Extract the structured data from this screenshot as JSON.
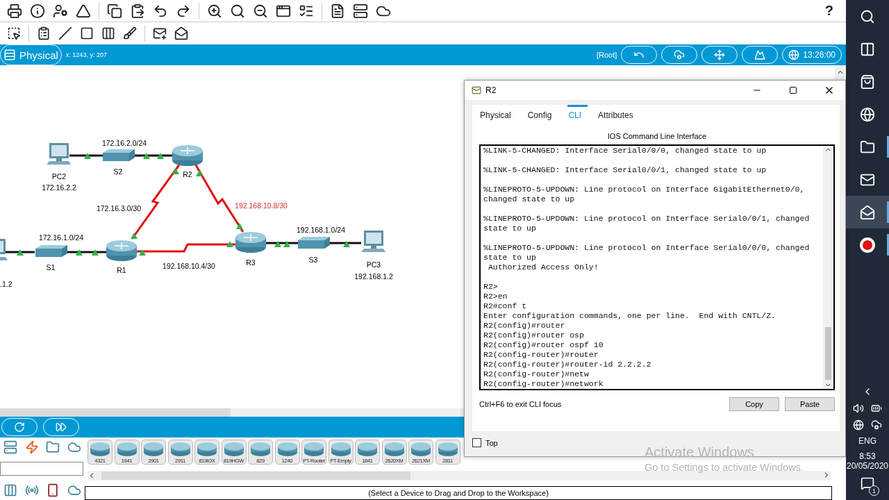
{
  "toolbar": {
    "help": "?"
  },
  "mode_bar": {
    "mode": "Physical",
    "coordinates": "x: 1243, y: 207",
    "root": "[Root]",
    "time": "13:26:00"
  },
  "topology": {
    "devices": [
      {
        "kind": "pc",
        "name": "PC2",
        "address": "172.16.2.2"
      },
      {
        "kind": "switch",
        "name": "S2"
      },
      {
        "kind": "router",
        "name": "R2"
      },
      {
        "kind": "pc",
        "address": ".1.2"
      },
      {
        "kind": "switch",
        "name": "S1"
      },
      {
        "kind": "router",
        "name": "R1"
      },
      {
        "kind": "router",
        "name": "R3"
      },
      {
        "kind": "switch",
        "name": "S3"
      },
      {
        "kind": "pc",
        "name": "PC3",
        "address": "192.168.1.2"
      }
    ],
    "networks": [
      {
        "label": "172.16.2.0/24"
      },
      {
        "label": "172.16.3.0/30"
      },
      {
        "label": "192.168.10.8/30",
        "color": "#d0312d"
      },
      {
        "label": "172.16.1.0/24"
      },
      {
        "label": "192.168.10.4/30"
      },
      {
        "label": "192.168.1.0/24"
      }
    ]
  },
  "device_panel": {
    "models": [
      "4321",
      "1941",
      "2901",
      "2911",
      "819IOX",
      "819HGW",
      "829",
      "1240",
      "PT-Router",
      "PT-Empty",
      "1841",
      "2620XM",
      "2621XM",
      "2811"
    ],
    "hint": "(Select a Device to Drag and Drop to the Workspace)"
  },
  "cli_window": {
    "title": "R2",
    "tabs": [
      {
        "label": "Physical",
        "selected": false
      },
      {
        "label": "Config",
        "selected": false
      },
      {
        "label": "CLI",
        "selected": true
      },
      {
        "label": "Attributes",
        "selected": false
      }
    ],
    "heading": "IOS Command Line Interface",
    "output": [
      [
        "%LINK-5-CHANGED: Interface Serial0/0/0, changed state to up"
      ],
      [
        "%LINK-5-CHANGED: Interface Serial0/0/1, changed state to up"
      ],
      [
        "%LINEPROTO-5-UPDOWN: Line protocol on Interface GigabitEthernet0/0,",
        "changed state to up"
      ],
      [
        "%LINEPROTO-5-UPDOWN: Line protocol on Interface Serial0/0/1, changed",
        "state to up"
      ],
      [
        "%LINEPROTO-5-UPDOWN: Line protocol on Interface Serial0/0/0, changed",
        "state to up",
        " Authorized Access Only!"
      ],
      [
        "R2>",
        "R2>en",
        "R2#conf t",
        "Enter configuration commands, one per line.  End with CNTL/Z.",
        "R2(config)#router",
        "R2(config)#router osp",
        "R2(config)#router ospf 10",
        "R2(config-router)#router",
        "R2(config-router)#router-id 2.2.2.2",
        "R2(config-router)#netw",
        "R2(config-router)#network "
      ]
    ],
    "focus_hint": "Ctrl+F6 to exit CLI focus",
    "buttons": [
      "Copy",
      "Paste"
    ],
    "top_checkbox": {
      "label": "Top",
      "checked": false
    }
  },
  "activation": {
    "title": "Activate Windows",
    "subtitle": "Go to Settings to activate Windows."
  },
  "taskbar": {
    "apps": [
      {
        "selected": false,
        "running": false
      },
      {
        "selected": false,
        "running": false
      },
      {
        "selected": false,
        "running": false
      },
      {
        "selected": false,
        "running": true
      },
      {
        "selected": false,
        "running": false
      },
      {
        "selected": true,
        "running": true
      },
      {
        "selected": false,
        "running": true
      }
    ],
    "language": "ENG",
    "time": "8:53",
    "date": "20/05/2020",
    "notifications": "1"
  }
}
